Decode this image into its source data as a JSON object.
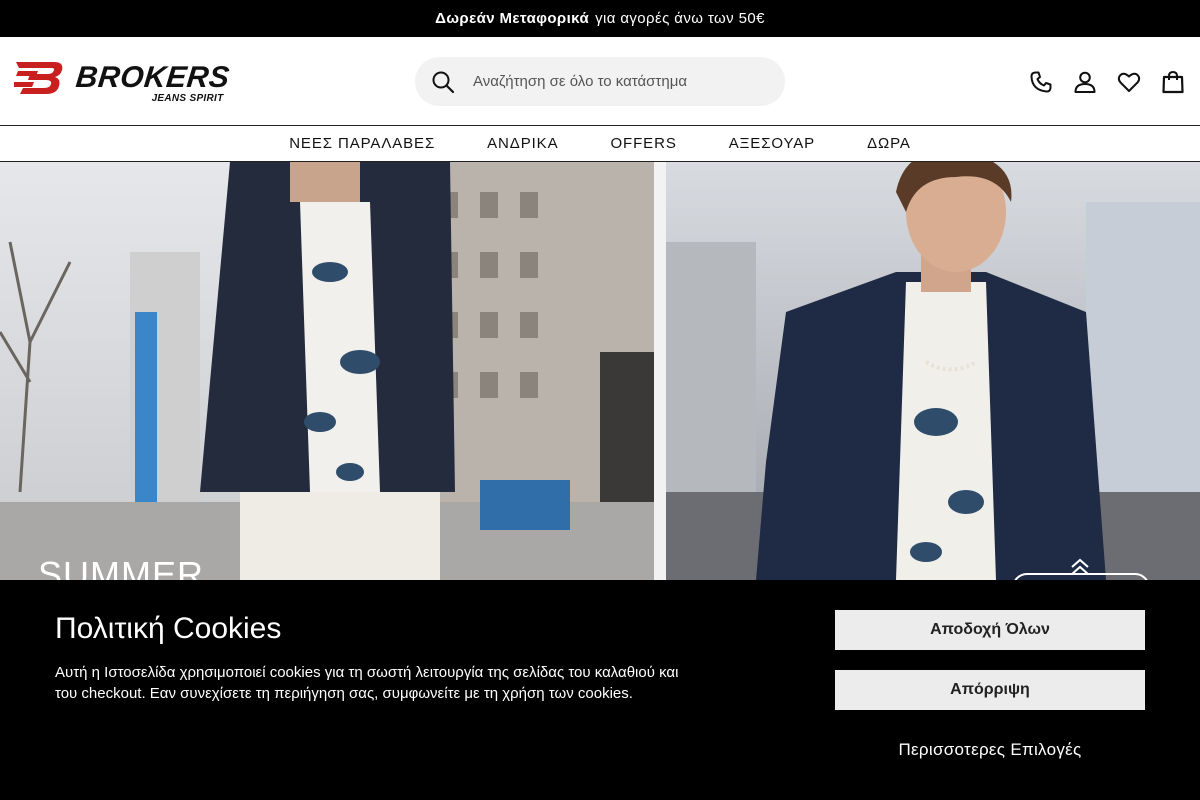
{
  "announcement": {
    "bold": "Δωρεάν Μεταφορικά",
    "rest": "για αγορές άνω των 50€"
  },
  "header": {
    "logo_text": "BROKERS",
    "logo_sub": "JEANS SPIRIT",
    "search": {
      "placeholder": "Αναζήτηση σε όλο το κατάστημα"
    },
    "icons": [
      "phone-icon",
      "account-icon",
      "wishlist-icon",
      "cart-icon"
    ]
  },
  "nav": {
    "items": [
      {
        "label": "ΝΕΕΣ ΠΑΡΑΛΑΒΕΣ"
      },
      {
        "label": "ΑΝΔΡΙΚΑ"
      },
      {
        "label": "OFFERS"
      },
      {
        "label": "ΑΞΕΣΟΥΑΡ"
      },
      {
        "label": "ΔΩΡΑ"
      }
    ]
  },
  "hero": {
    "title": "SUMMER"
  },
  "cookie_banner": {
    "title": "Πολιτική Cookies",
    "text": "Αυτή η Ιστοσελίδα χρησιμοποιεί cookies για τη σωστή λειτουργία της σελίδας του καλαθιού και του checkout. Εαν συνεχίσετε τη περιήγηση σας, συμφωνείτε με τη χρήση των cookies.",
    "accept_label": "Αποδοχή Όλων",
    "reject_label": "Απόρριψη",
    "more_label": "Περισσοτερες Επιλογές"
  },
  "colors": {
    "brand_red": "#c8201e",
    "topbar_bg": "#000000",
    "cookie_bg": "#000000",
    "button_bg": "#ececec",
    "search_bg": "#f2f2f2"
  }
}
